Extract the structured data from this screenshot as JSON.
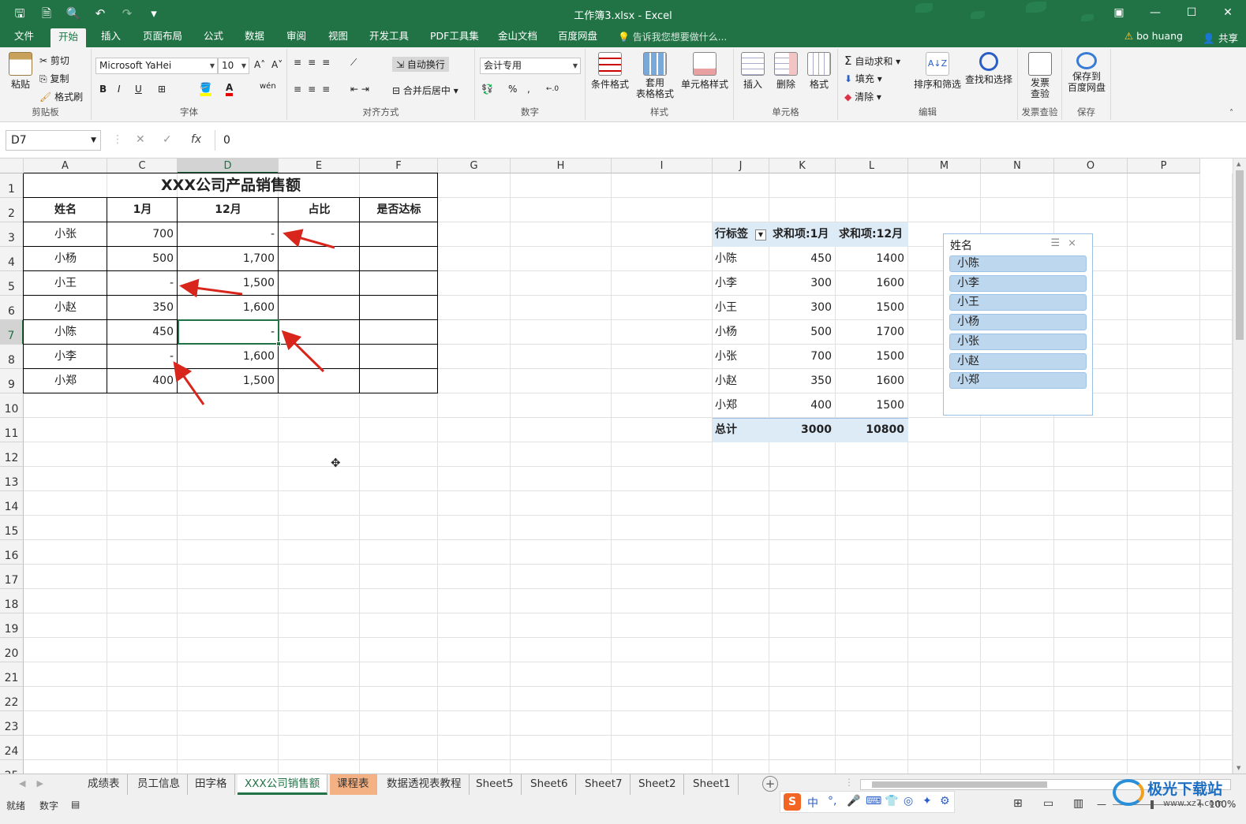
{
  "window": {
    "title": "工作簿3.xlsx - Excel",
    "qat_icons": [
      "save-icon",
      "save-as-icon",
      "print-preview-icon",
      "undo-icon",
      "redo-icon",
      "customize-icon"
    ],
    "qat_glyphs": [
      "🖫",
      "🗎",
      "🔍",
      "↶",
      "↷",
      "▾"
    ],
    "controls": [
      "▣",
      "—",
      "☐",
      "✕"
    ]
  },
  "tabs": [
    "文件",
    "开始",
    "插入",
    "页面布局",
    "公式",
    "数据",
    "审阅",
    "视图",
    "开发工具",
    "PDF工具集",
    "金山文档",
    "百度网盘"
  ],
  "active_tab": "开始",
  "tell_me": "告诉我您想要做什么...",
  "user": "bo huang",
  "share": "共享",
  "ribbon": {
    "clipboard": {
      "label": "剪贴板",
      "paste": "粘贴",
      "cut": "剪切",
      "copy": "复制",
      "format_painter": "格式刷"
    },
    "font": {
      "label": "字体",
      "name": "Microsoft YaHei",
      "size": "10",
      "grow": "A˄",
      "shrink": "A˅",
      "bold": "B",
      "italic": "I",
      "underline": "U",
      "phonetic": "wén"
    },
    "alignment": {
      "label": "对齐方式",
      "wrap": "自动换行",
      "merge": "合并后居中"
    },
    "number": {
      "label": "数字",
      "format": "会计专用",
      "percent": "%",
      "comma": ",",
      "inc_dec": "←.0",
      "dec_dec": ".00→"
    },
    "styles": {
      "label": "样式",
      "conditional": "条件格式",
      "table_line1": "套用",
      "table_line2": "表格格式",
      "cell_styles": "单元格样式"
    },
    "cells": {
      "label": "单元格",
      "insert": "插入",
      "delete": "删除",
      "format": "格式"
    },
    "editing": {
      "label": "编辑",
      "autosum": "自动求和",
      "fill": "填充",
      "clear": "清除",
      "sort": "排序和筛选",
      "find": "查找和选择"
    },
    "invoice": {
      "label": "发票查验",
      "btn_line1": "发票",
      "btn_line2": "查验"
    },
    "save": {
      "label": "保存",
      "btn_line1": "保存到",
      "btn_line2": "百度网盘"
    }
  },
  "formula_bar": {
    "name_box": "D7",
    "formula": "0",
    "fx": "fx",
    "cancel": "✕",
    "enter": "✓"
  },
  "columns": [
    "A",
    "C",
    "D",
    "E",
    "F",
    "G",
    "H",
    "I",
    "J",
    "K",
    "L",
    "M",
    "N",
    "O",
    "P"
  ],
  "rows": [
    "1",
    "2",
    "3",
    "4",
    "5",
    "6",
    "7",
    "8",
    "9",
    "10",
    "11",
    "12",
    "13",
    "14",
    "15",
    "16",
    "17",
    "18",
    "19",
    "20",
    "21",
    "22",
    "23",
    "24",
    "25"
  ],
  "table": {
    "title": "XXX公司产品销售额",
    "headers": [
      "姓名",
      "1月",
      "12月",
      "占比",
      "是否达标"
    ],
    "rows": [
      [
        "小张",
        "700",
        "-",
        "",
        ""
      ],
      [
        "小杨",
        "500",
        "1,700",
        "",
        ""
      ],
      [
        "小王",
        "-",
        "1,500",
        "",
        ""
      ],
      [
        "小赵",
        "350",
        "1,600",
        "",
        ""
      ],
      [
        "小陈",
        "450",
        "-",
        "",
        ""
      ],
      [
        "小李",
        "-",
        "1,600",
        "",
        ""
      ],
      [
        "小郑",
        "400",
        "1,500",
        "",
        ""
      ]
    ]
  },
  "pivot": {
    "headers": [
      "行标签",
      "求和项:1月",
      "求和项:12月"
    ],
    "rows": [
      [
        "小陈",
        "450",
        "1400"
      ],
      [
        "小李",
        "300",
        "1600"
      ],
      [
        "小王",
        "300",
        "1500"
      ],
      [
        "小杨",
        "500",
        "1700"
      ],
      [
        "小张",
        "700",
        "1500"
      ],
      [
        "小赵",
        "350",
        "1600"
      ],
      [
        "小郑",
        "400",
        "1500"
      ]
    ],
    "total": [
      "总计",
      "3000",
      "10800"
    ]
  },
  "slicer": {
    "title": "姓名",
    "items": [
      "小陈",
      "小李",
      "小王",
      "小杨",
      "小张",
      "小赵",
      "小郑"
    ]
  },
  "sheets": [
    "成绩表",
    "员工信息",
    "田字格",
    "XXX公司销售额",
    "课程表",
    "数据透视表教程",
    "Sheet5",
    "Sheet6",
    "Sheet7",
    "Sheet2",
    "Sheet1"
  ],
  "active_sheet": "XXX公司销售额",
  "status": {
    "ready": "就绪",
    "numlock": "数字",
    "zoom": "100%"
  },
  "ime": {
    "logo": "S",
    "mode": "中",
    "punct": "°,",
    "tools": [
      "🎤",
      "⌨",
      "👕",
      "◎",
      "✦",
      "⚙"
    ]
  },
  "watermark": {
    "name": "极光下载站",
    "url": "www.xz7.com"
  },
  "colors": {
    "brand": "#217346",
    "accent_arrow": "#d9261c",
    "pivot_header": "#ddebf7",
    "slicer_item": "#bdd7ee"
  }
}
